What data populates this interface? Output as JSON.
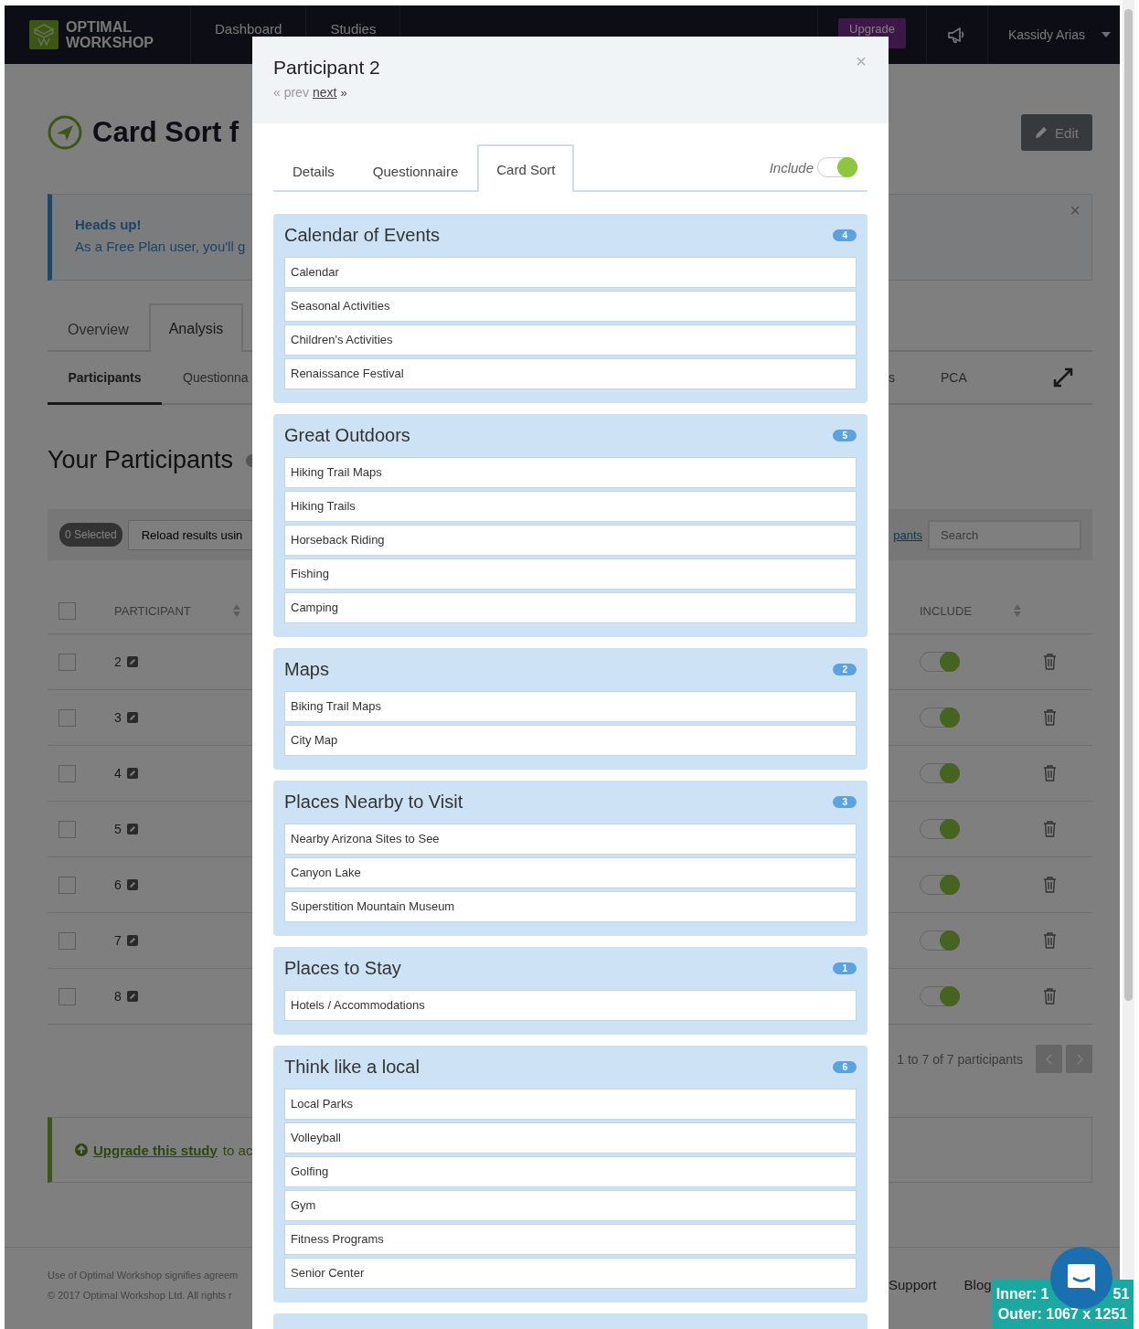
{
  "nav": {
    "logo": "OPTIMAL WORKSHOP",
    "links": [
      {
        "label": "Dashboard"
      },
      {
        "label": "Studies"
      }
    ],
    "upgrade": "Upgrade",
    "user": "Kassidy Arias"
  },
  "study": {
    "title": "Card Sort f",
    "edit": "Edit"
  },
  "alert": {
    "heading": "Heads up!",
    "text": "As a Free Plan user, you'll g",
    "close": "×"
  },
  "tabs": [
    {
      "label": "Overview",
      "selected": false
    },
    {
      "label": "Analysis",
      "selected": true
    }
  ],
  "subtabs_left": [
    {
      "label": "Participants",
      "selected": true
    },
    {
      "label": "Questionna",
      "selected": false
    }
  ],
  "subtabs_right": [
    {
      "label": "s",
      "selected": false
    },
    {
      "label": "PCA",
      "selected": false
    }
  ],
  "participants": {
    "title": "Your Participants",
    "selected_count": "0 Selected",
    "reload": "Reload results usin",
    "link": "pants",
    "search": {
      "placeholder": "Search"
    },
    "select_all": {
      "checked": false
    },
    "columns": [
      "PARTICIPANT",
      "INCLUDE"
    ],
    "rows": [
      {
        "id": "2",
        "checked": false,
        "include": true
      },
      {
        "id": "3",
        "checked": false,
        "include": true
      },
      {
        "id": "4",
        "checked": false,
        "include": true
      },
      {
        "id": "5",
        "checked": false,
        "include": true
      },
      {
        "id": "6",
        "checked": false,
        "include": true
      },
      {
        "id": "7",
        "checked": false,
        "include": true
      },
      {
        "id": "8",
        "checked": false,
        "include": true
      }
    ],
    "pagination": "1 to 7 of 7 participants"
  },
  "upgrade_notice": {
    "link": "Upgrade this study",
    "text": "to ac"
  },
  "footer": {
    "lines": [
      "Use of Optimal Workshop signifies agreem",
      "© 2017 Optimal Workshop Ltd. All rights r"
    ],
    "links": [
      "Support",
      "Blog"
    ]
  },
  "modal": {
    "title": "Participant 2",
    "prev": "« prev",
    "next": "next",
    "next_arrow": "»",
    "close": "×",
    "tabs": [
      {
        "label": "Details",
        "selected": false
      },
      {
        "label": "Questionnaire",
        "selected": false
      },
      {
        "label": "Card Sort",
        "selected": true
      }
    ],
    "include": {
      "label": "Include",
      "on": true
    },
    "groups": [
      {
        "title": "Calendar of Events",
        "count": "4",
        "cards": [
          "Calendar",
          "Seasonal Activities",
          "Children's Activities",
          "Renaissance Festival"
        ]
      },
      {
        "title": "Great Outdoors",
        "count": "5",
        "cards": [
          "Hiking Trail Maps",
          "Hiking Trails",
          "Horseback Riding",
          "Fishing",
          "Camping"
        ]
      },
      {
        "title": "Maps",
        "count": "2",
        "cards": [
          "Biking Trail Maps",
          "City Map"
        ]
      },
      {
        "title": "Places Nearby to Visit",
        "count": "3",
        "cards": [
          "Nearby Arizona Sites to See",
          "Canyon Lake",
          "Superstition Mountain Museum"
        ]
      },
      {
        "title": "Places to Stay",
        "count": "1",
        "cards": [
          "Hotels / Accommodations"
        ]
      },
      {
        "title": "Think like a local",
        "count": "6",
        "cards": [
          "Local Parks",
          "Volleyball",
          "Golfing",
          "Gym",
          "Fitness Programs",
          "Senior Center"
        ]
      }
    ]
  },
  "resizer": {
    "inner": "Inner: 1",
    "inner_tail": "51",
    "outer": "Outer: 1067 x 1251"
  }
}
